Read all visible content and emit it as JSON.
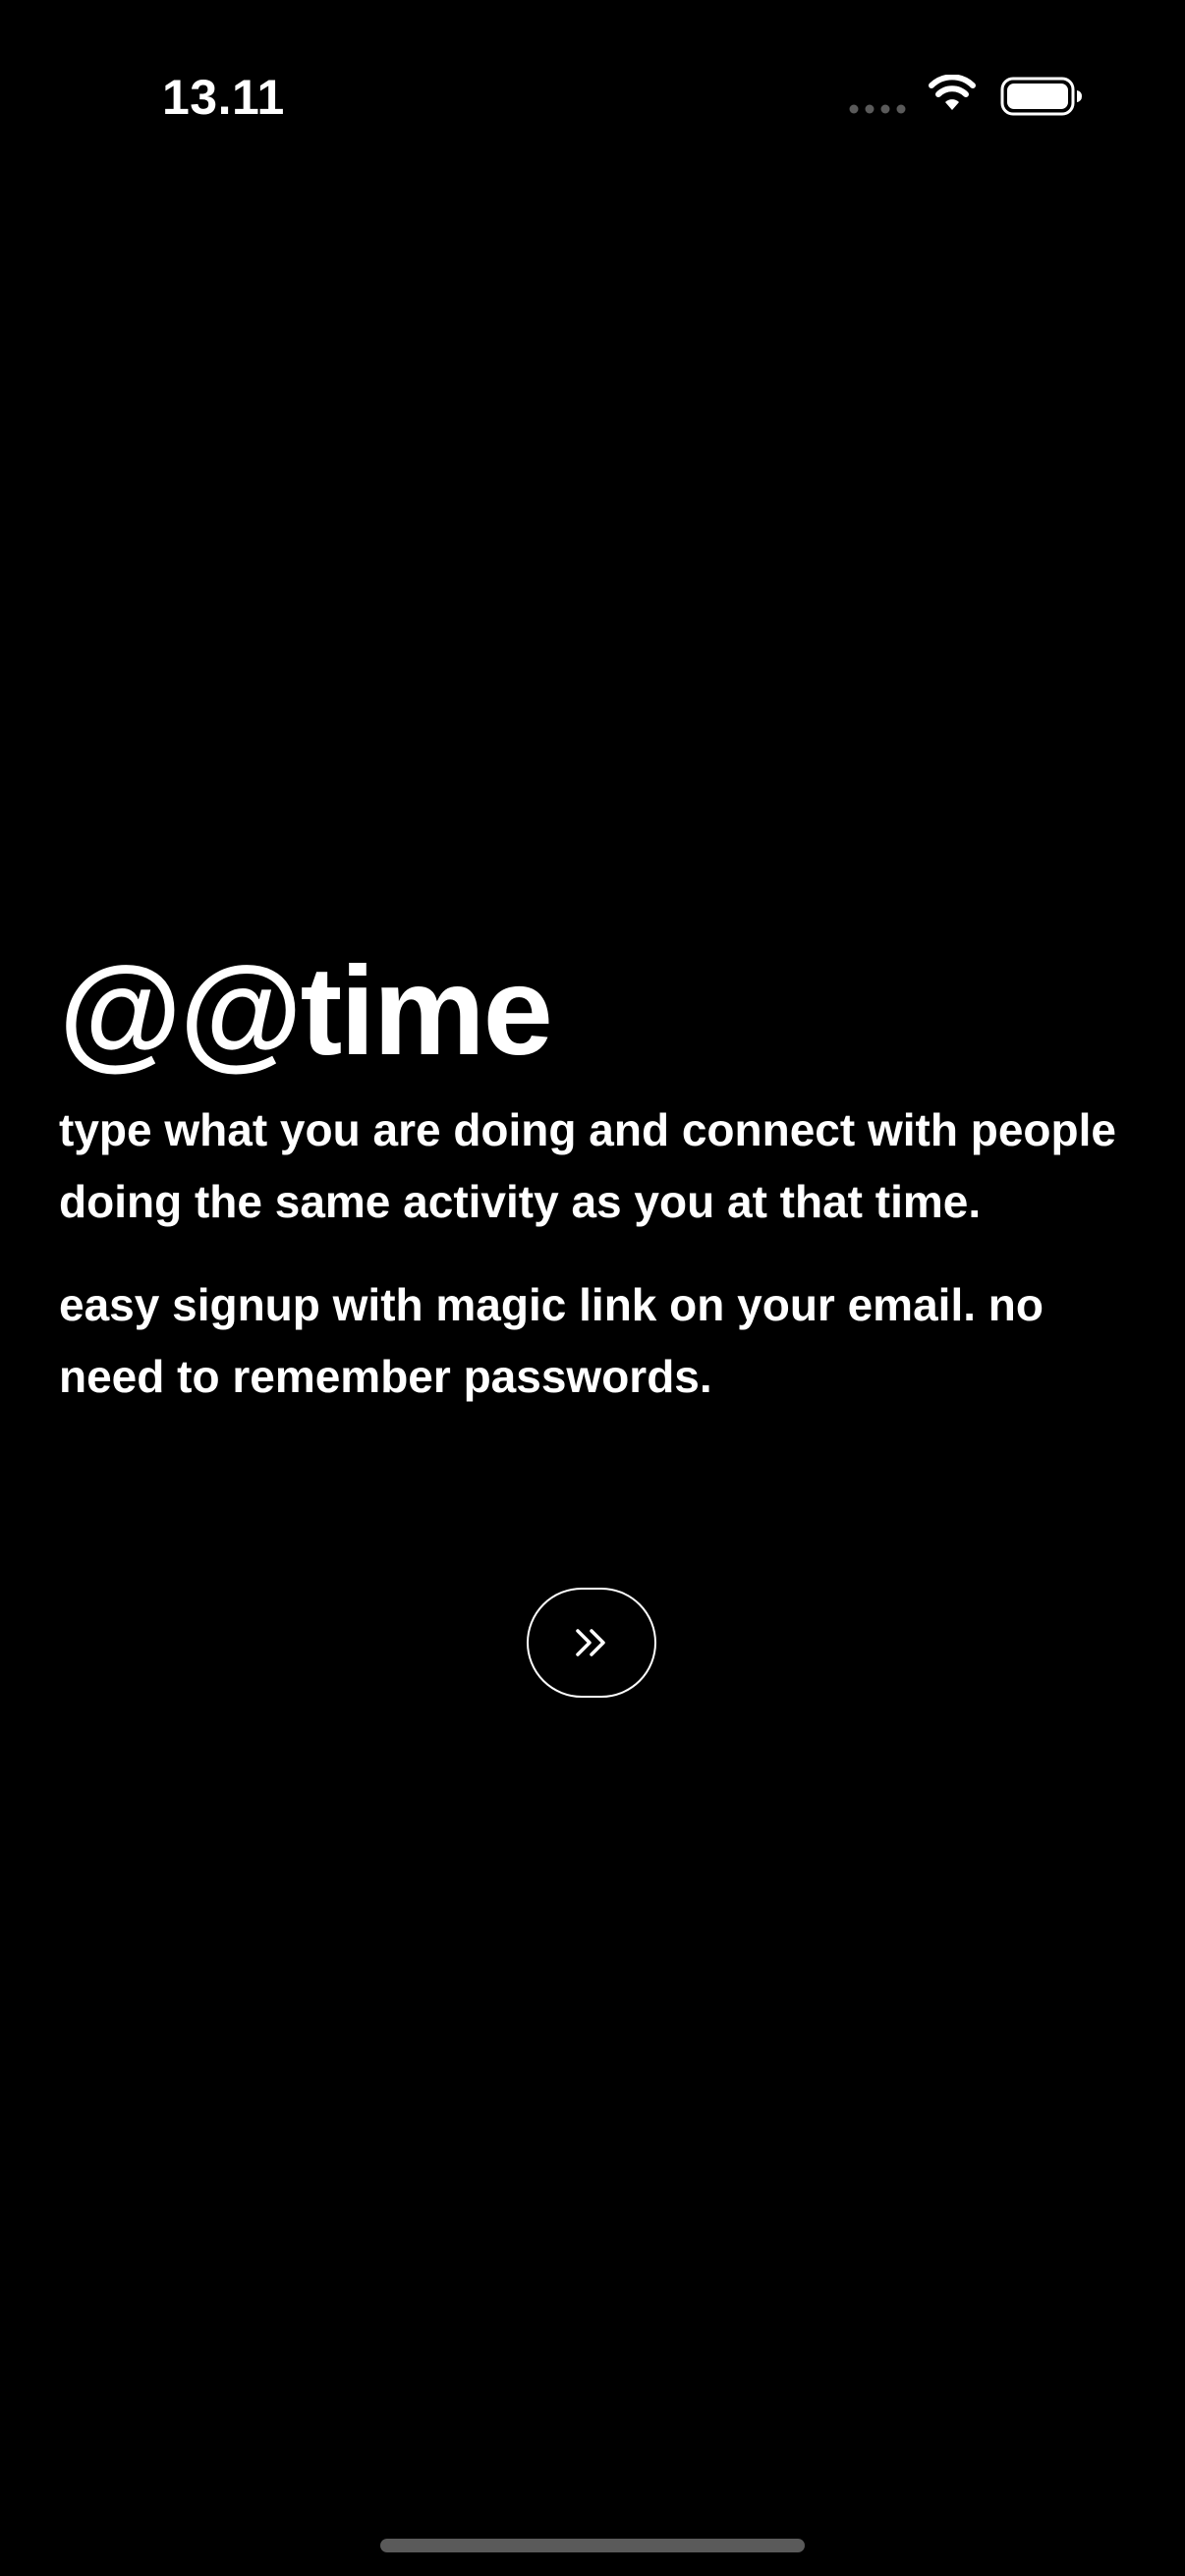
{
  "status_bar": {
    "time": "13.11",
    "icons": [
      "signal-dots-icon",
      "wifi-icon",
      "battery-icon"
    ]
  },
  "intro": {
    "title": "@@time",
    "description_1": "type what you are doing and connect with people doing the same activity as you at that time.",
    "description_2": "easy signup with magic link on your email. no need to remember passwords."
  },
  "next_button": {
    "icon": "chevrons-right-icon"
  },
  "colors": {
    "background": "#000000",
    "text": "#ffffff",
    "home_indicator": "#5a5a5a"
  }
}
